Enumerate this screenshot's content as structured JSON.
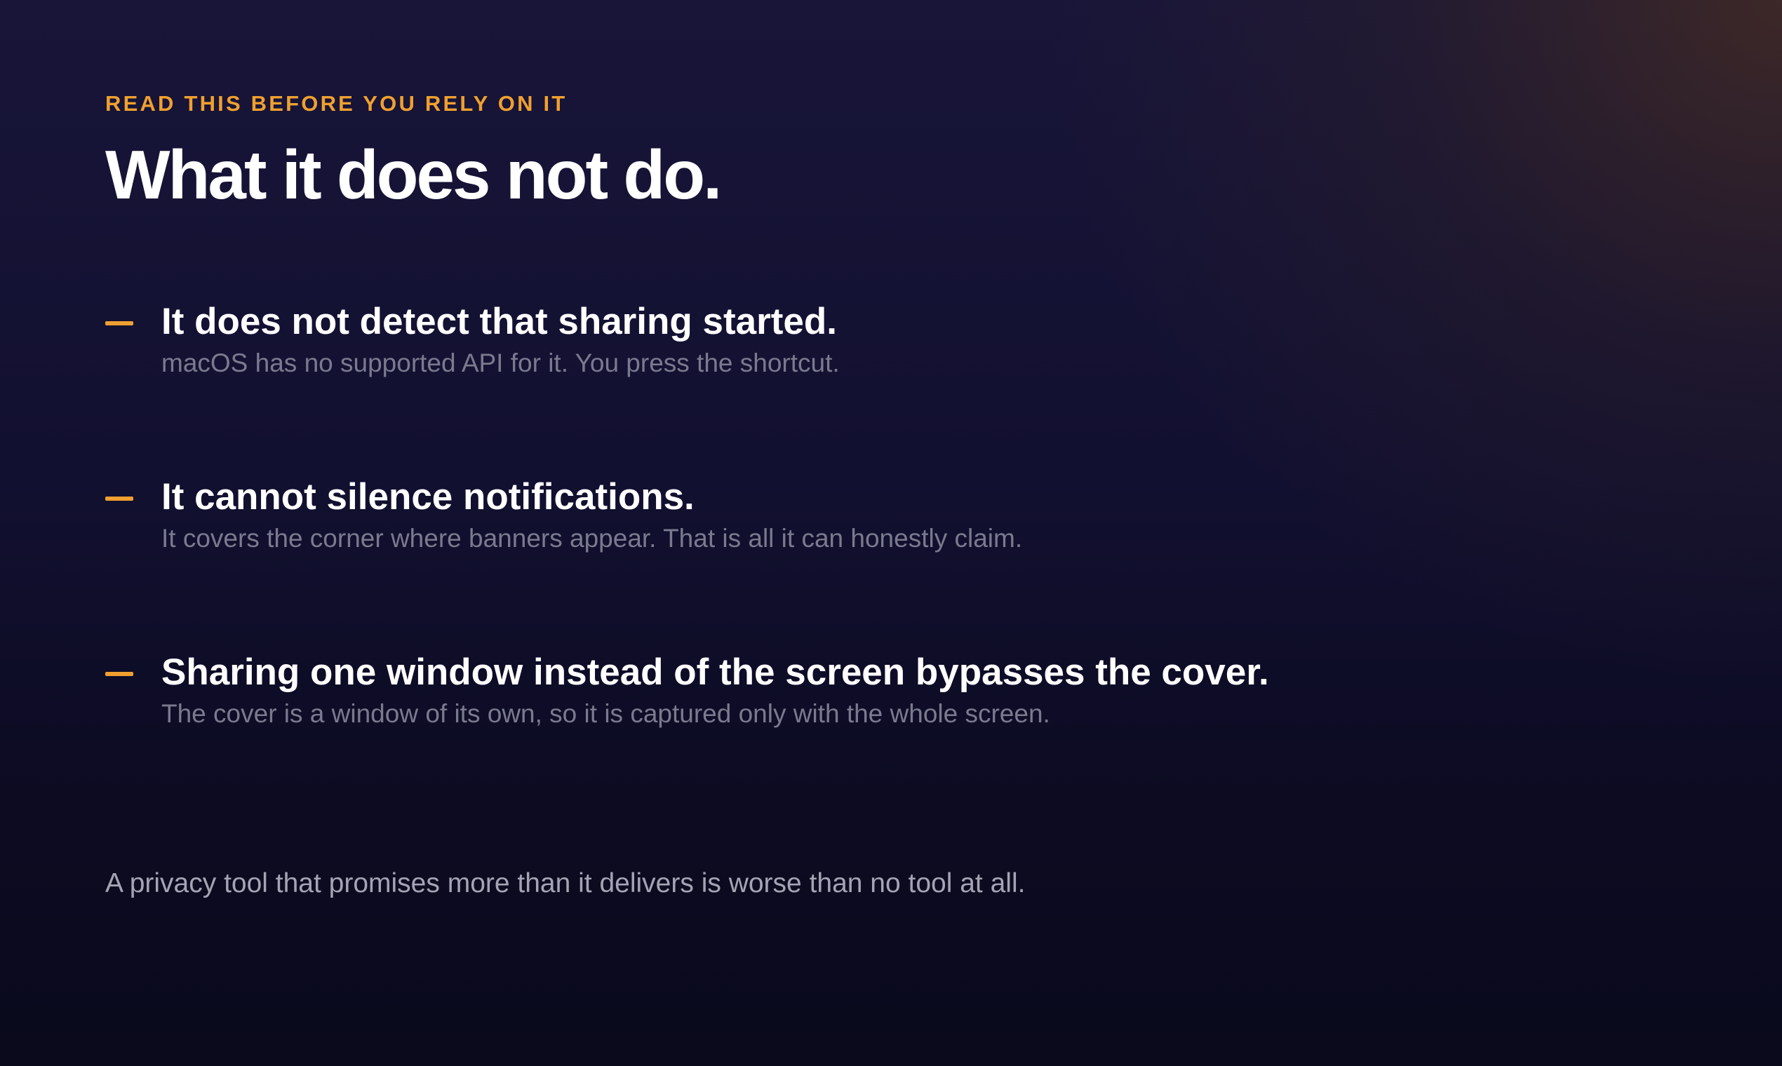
{
  "eyebrow": "READ THIS BEFORE YOU RELY ON IT",
  "title": "What it does not do.",
  "items": [
    {
      "heading": "It does not detect that sharing started.",
      "description": "macOS has no supported API for it. You press the shortcut."
    },
    {
      "heading": "It cannot silence notifications.",
      "description": "It covers the corner where banners appear. That is all it can honestly claim."
    },
    {
      "heading": "Sharing one window instead of the screen bypasses the cover.",
      "description": "The cover is a window of its own, so it is captured only with the whole screen."
    }
  ],
  "footer": "A privacy tool that promises more than it delivers is worse than no tool at all.",
  "colors": {
    "accent": "#f0a030",
    "heading": "#ffffff",
    "description": "#7a7a8f",
    "footer": "#a4a4b4",
    "background_top": "#181539",
    "background_bottom": "#0a0a1c"
  },
  "icons": {
    "bullet": "dash-icon"
  }
}
